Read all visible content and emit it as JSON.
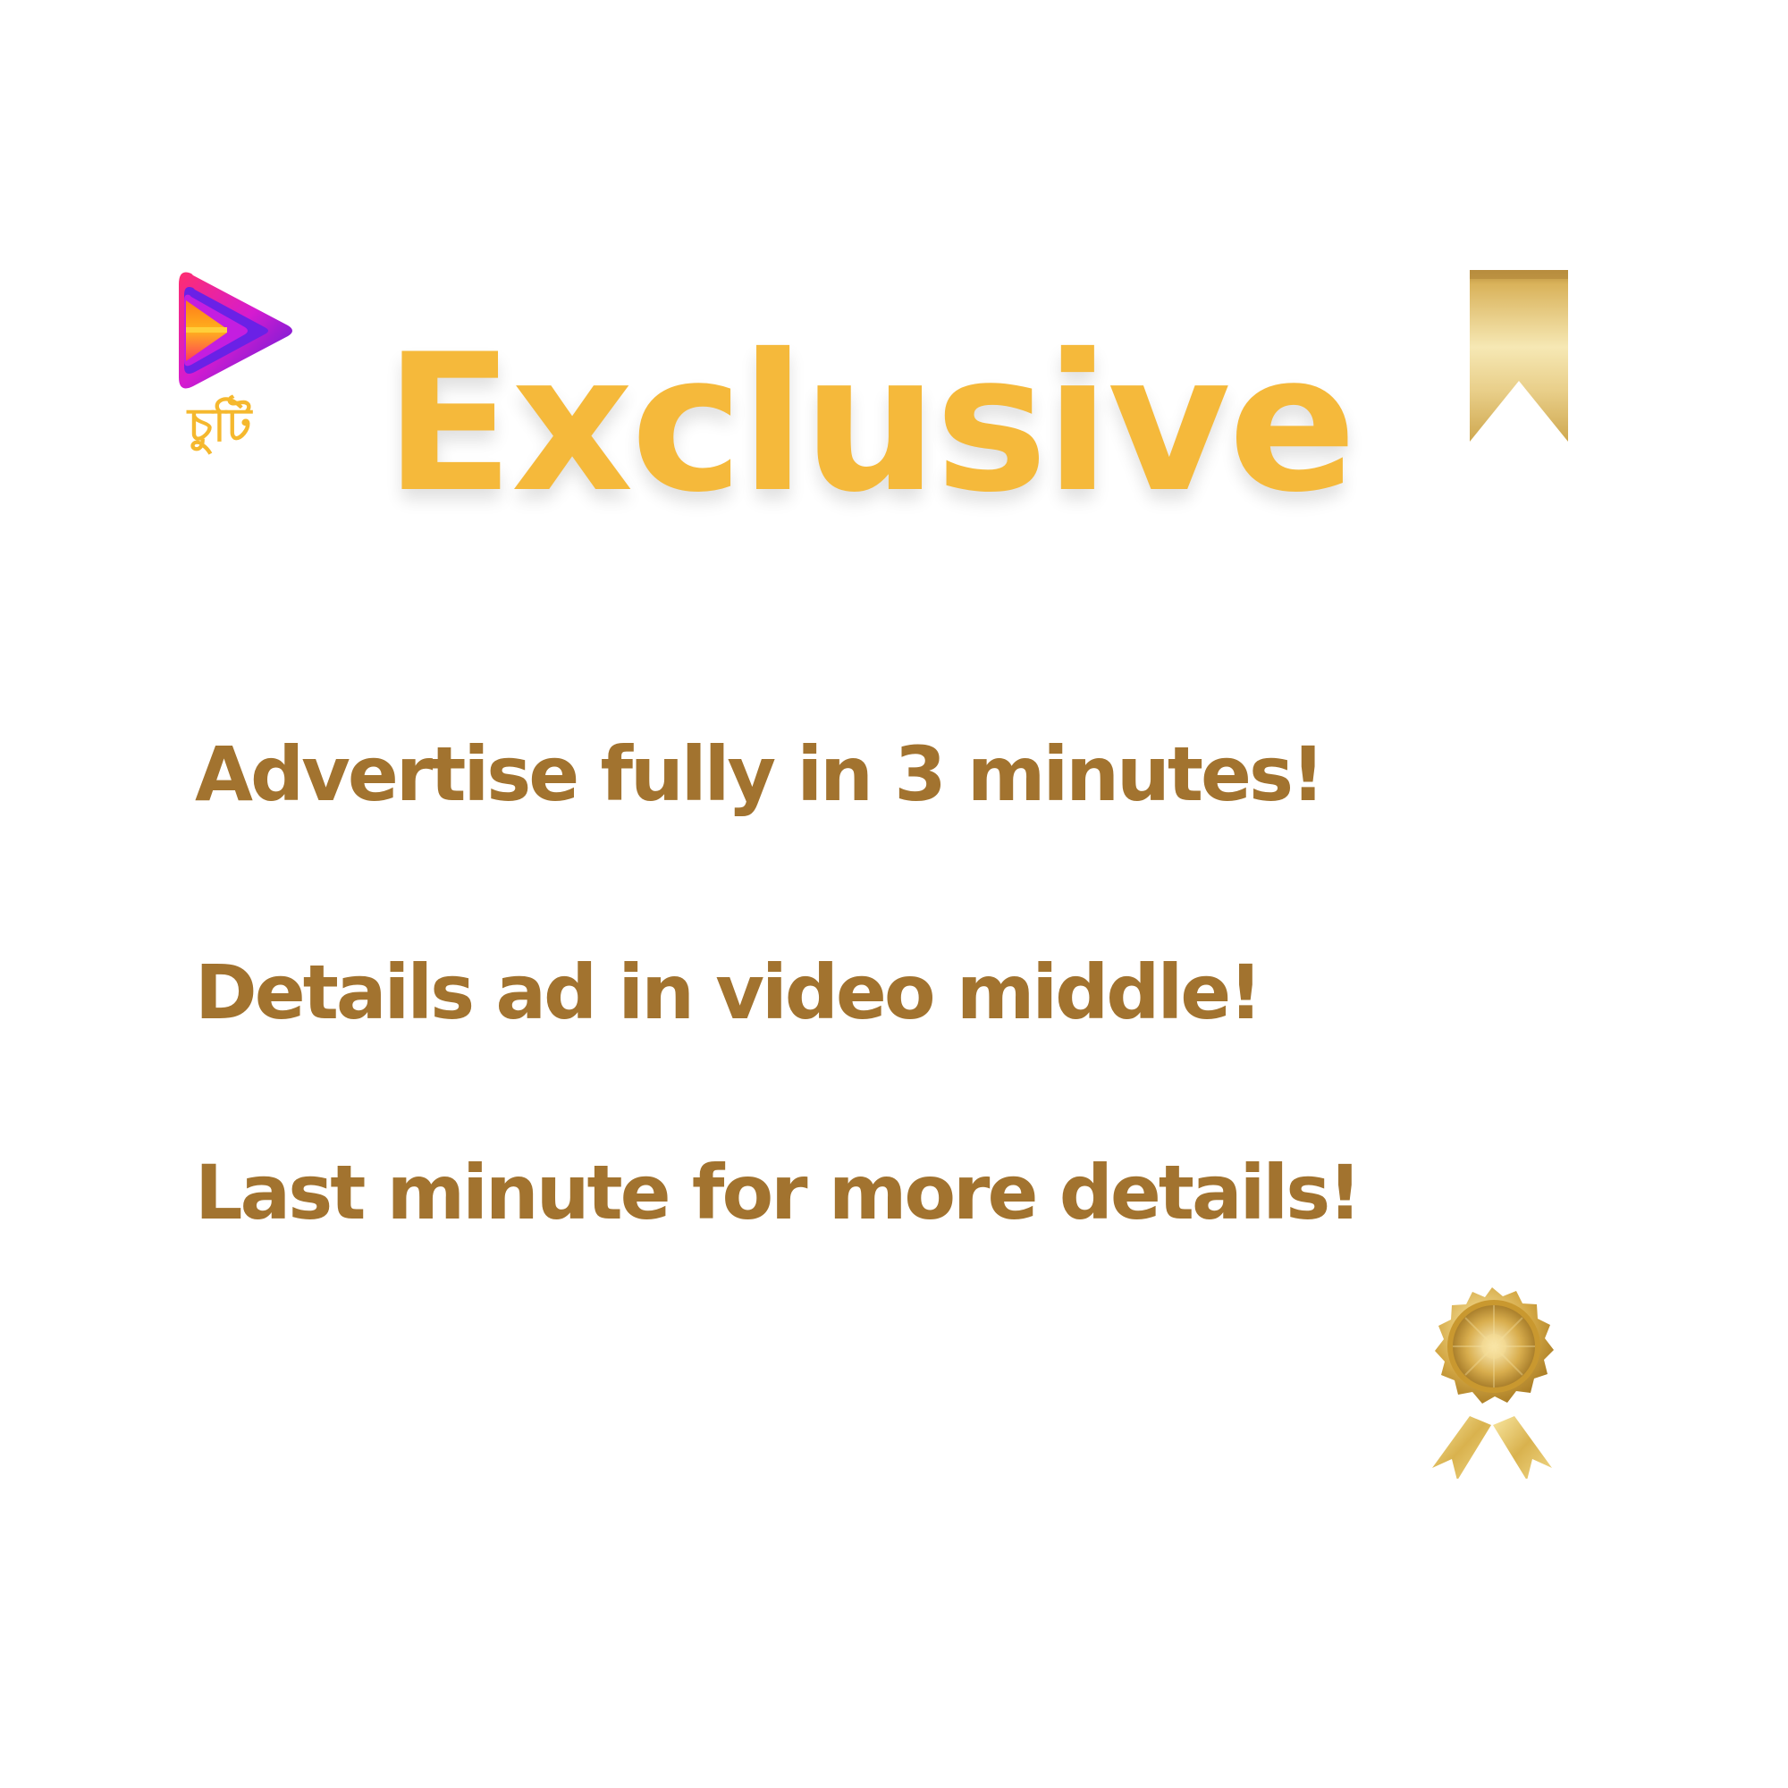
{
  "logo": {
    "icon": "play-icon",
    "text": "চুটি"
  },
  "title": "Exclusive",
  "features": [
    "Advertise fully in 3 minutes!",
    "Details ad in video middle!",
    "Last minute for more details!"
  ],
  "decorations": {
    "ribbon": "bookmark-ribbon-icon",
    "medal": "gold-medal-icon"
  },
  "colors": {
    "title": "#f5b93b",
    "body_text": "#a2732f",
    "logo_text": "#f5b82e",
    "gold": "#d4ae4f"
  }
}
